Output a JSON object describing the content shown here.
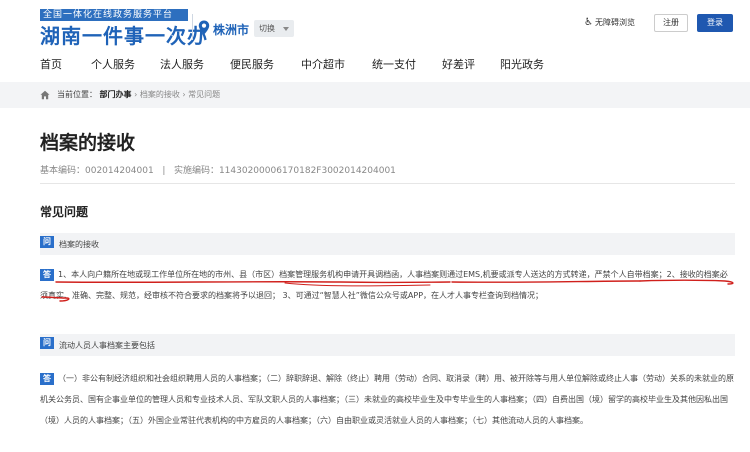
{
  "header": {
    "platform_tagline": "全国一体化在线政务服务平台",
    "site_name": "湖南一件事一次办",
    "city": "株洲市",
    "switch_label": "切换",
    "accessibility_label": "无障碍浏览",
    "register_label": "注册",
    "login_label": "登录",
    "brand_color": "#1f63b8"
  },
  "nav": {
    "items": [
      {
        "label": "首页"
      },
      {
        "label": "个人服务"
      },
      {
        "label": "法人服务"
      },
      {
        "label": "便民服务"
      },
      {
        "label": "中介超市"
      },
      {
        "label": "统一支付"
      },
      {
        "label": "好差评"
      },
      {
        "label": "阳光政务"
      }
    ]
  },
  "breadcrumb": {
    "prefix": "当前位置：",
    "level1": "部门办事",
    "level2": "档案的接收",
    "level3": "常见问题",
    "separator": "›"
  },
  "page": {
    "title": "档案的接收",
    "basic_code": "基本编码：002014204001",
    "divider": "|",
    "impl_code": "实施编码：11430200006170182F3002014204001"
  },
  "faq": {
    "section_title": "常见问题",
    "q_badge": "问",
    "a_badge": "答",
    "items": [
      {
        "question": "档案的接收",
        "answer": "1、本人向户籍所在地或现工作单位所在地的市州、县（市区）档案管理服务机构申请开具调档函，人事档案则通过EMS,机要或派专人送达的方式转递，严禁个人自带档案；2、接收的档案必须真实、准确、完整、规范，经审核不符合要求的档案将予以退回； 3、可通过“智慧人社”微信公众号或APP，在人才人事专栏查询到档情况；"
      },
      {
        "question": "流动人员人事档案主要包括",
        "answer": "（一）非公有制经济组织和社会组织聘用人员的人事档案；（二）辞职辞退、解除（终止）聘用（劳动）合同、取消录（聘）用、被开除等与用人单位解除或终止人事（劳动）关系的未就业的原机关公务员、国有企事业单位的管理人员和专业技术人员、军队文职人员的人事档案；（三）未就业的高校毕业生及中专毕业生的人事档案；（四）自费出国（境）留学的高校毕业生及其他因私出国（境）人员的人事档案；（五）外国企业常驻代表机构的中方雇员的人事档案；（六）自由职业或灵活就业人员的人事档案；（七）其他流动人员的人事档案。"
      }
    ]
  },
  "colors": {
    "accent": "#2a6fca",
    "annotation_red": "#d0201c"
  }
}
